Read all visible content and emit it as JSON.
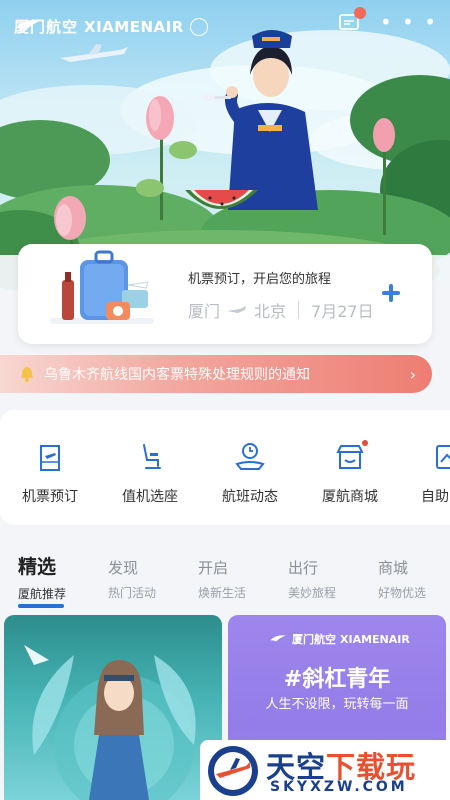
{
  "header": {
    "logo_cn": "厦门航空",
    "logo_en": "XIAMENAIR",
    "icons": [
      "message-icon",
      "more-icon"
    ],
    "more_label": "• • •"
  },
  "booking": {
    "title": "机票预订，开启您的旅程",
    "from": "厦门",
    "to": "北京",
    "date": "7月27日"
  },
  "notice": {
    "text": "乌鲁木齐航线国内客票特殊处理规则的通知",
    "arrow": "›"
  },
  "quicknav": {
    "items": [
      {
        "label": "机票预订",
        "icon": "ticket-icon"
      },
      {
        "label": "值机选座",
        "icon": "seat-icon"
      },
      {
        "label": "航班动态",
        "icon": "flight-status-icon"
      },
      {
        "label": "厦航商城",
        "icon": "shop-icon"
      },
      {
        "label": "自助",
        "icon": "self-service-icon"
      }
    ]
  },
  "tabs": [
    {
      "title": "精选",
      "sub": "厦航推荐",
      "active": true
    },
    {
      "title": "发现",
      "sub": "热门活动"
    },
    {
      "title": "开启",
      "sub": "焕新生活"
    },
    {
      "title": "出行",
      "sub": "美妙旅程"
    },
    {
      "title": "商城",
      "sub": "好物优选"
    }
  ],
  "promo_right": {
    "logo_cn": "厦门航空",
    "logo_en": "XIAMENAIR",
    "hashtag": "#斜杠青年",
    "slogan": "人生不设限，玩转每一面"
  },
  "watermark": {
    "title_a": "天空",
    "title_b": "下载玩",
    "sub": "SKYXZW.COM"
  },
  "colors": {
    "brand_blue": "#2a6fd6",
    "notice_red": "#ee7d72",
    "promo_purple": "#9d86ec",
    "promo_teal": "#46b3b4"
  }
}
